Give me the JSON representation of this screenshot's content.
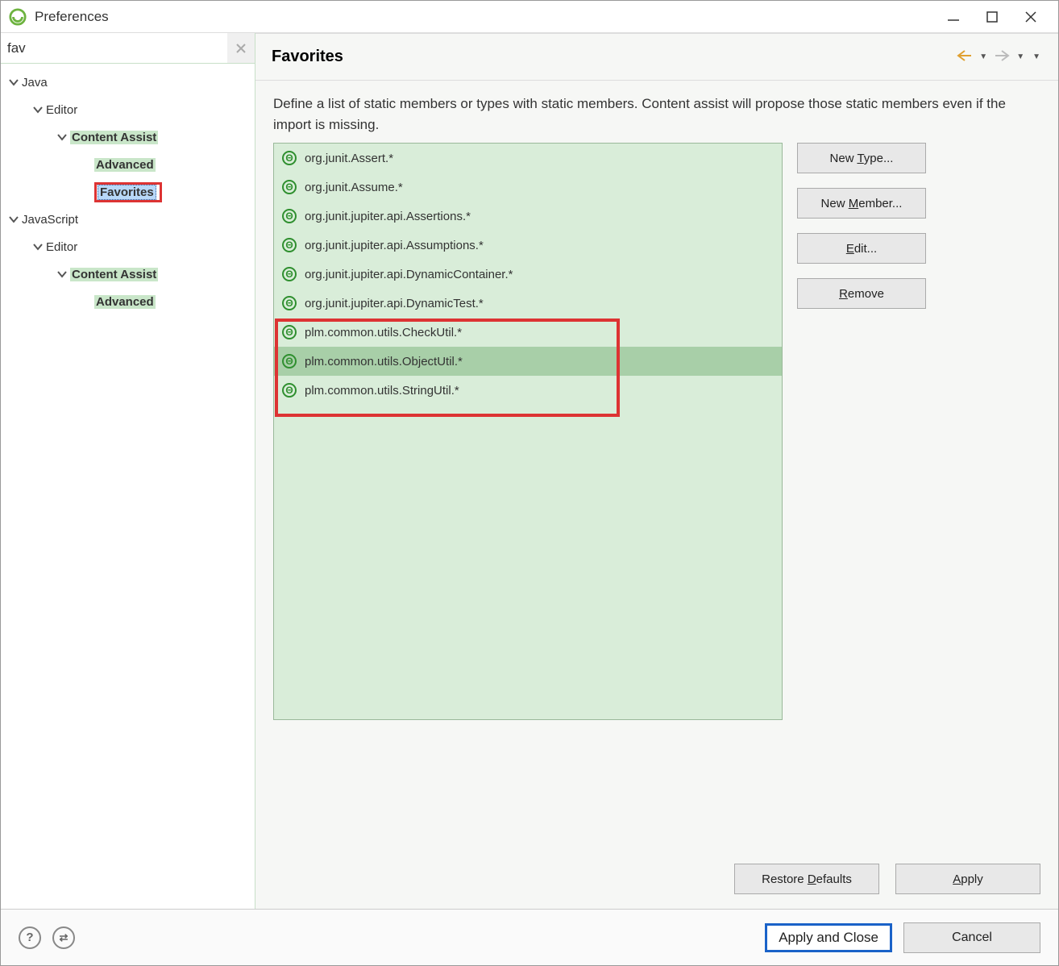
{
  "window": {
    "title": "Preferences"
  },
  "search": {
    "value": "fav"
  },
  "tree": [
    {
      "level": 0,
      "label": "Java",
      "expanded": true,
      "bold": false,
      "highlight": false,
      "selected": false
    },
    {
      "level": 1,
      "label": "Editor",
      "expanded": true,
      "bold": false,
      "highlight": false,
      "selected": false
    },
    {
      "level": 2,
      "label": "Content Assist",
      "expanded": true,
      "bold": true,
      "highlight": true,
      "selected": false
    },
    {
      "level": 3,
      "label": "Advanced",
      "expanded": false,
      "bold": true,
      "highlight": true,
      "selected": false,
      "leaf": true
    },
    {
      "level": 3,
      "label": "Favorites",
      "expanded": false,
      "bold": true,
      "highlight": true,
      "selected": true,
      "leaf": true,
      "redbox": true
    },
    {
      "level": 0,
      "label": "JavaScript",
      "expanded": true,
      "bold": false,
      "highlight": false,
      "selected": false
    },
    {
      "level": 1,
      "label": "Editor",
      "expanded": true,
      "bold": false,
      "highlight": false,
      "selected": false
    },
    {
      "level": 2,
      "label": "Content Assist",
      "expanded": true,
      "bold": true,
      "highlight": true,
      "selected": false
    },
    {
      "level": 3,
      "label": "Advanced",
      "expanded": false,
      "bold": true,
      "highlight": true,
      "selected": false,
      "leaf": true
    }
  ],
  "page": {
    "heading": "Favorites",
    "description": "Define a list of static members or types with static members. Content assist will propose those static members even if the import is missing."
  },
  "list": [
    {
      "text": "org.junit.Assert.*",
      "selected": false
    },
    {
      "text": "org.junit.Assume.*",
      "selected": false
    },
    {
      "text": "org.junit.jupiter.api.Assertions.*",
      "selected": false
    },
    {
      "text": "org.junit.jupiter.api.Assumptions.*",
      "selected": false
    },
    {
      "text": "org.junit.jupiter.api.DynamicContainer.*",
      "selected": false
    },
    {
      "text": "org.junit.jupiter.api.DynamicTest.*",
      "selected": false
    },
    {
      "text": "plm.common.utils.CheckUtil.*",
      "selected": false
    },
    {
      "text": "plm.common.utils.ObjectUtil.*",
      "selected": true
    },
    {
      "text": "plm.common.utils.StringUtil.*",
      "selected": false
    }
  ],
  "buttons": {
    "newType": "New Type...",
    "newMember": "New Member...",
    "edit": "Edit...",
    "remove": "Remove",
    "restoreDefaults": "Restore Defaults",
    "apply": "Apply",
    "applyAndClose": "Apply and Close",
    "cancel": "Cancel"
  }
}
